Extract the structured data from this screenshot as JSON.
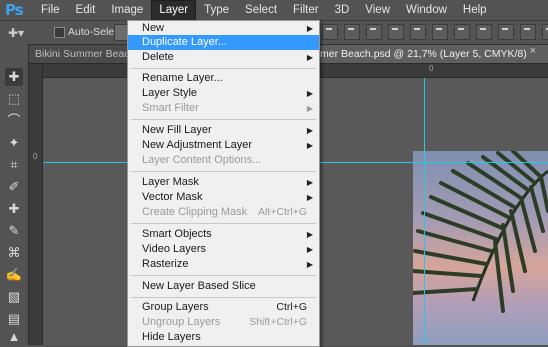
{
  "app": {
    "logo": "Ps"
  },
  "menubar": {
    "items": [
      "File",
      "Edit",
      "Image",
      "Layer",
      "Type",
      "Select",
      "Filter",
      "3D",
      "View",
      "Window",
      "Help"
    ],
    "active": "Layer"
  },
  "options": {
    "auto_select_label": "Auto-Select:"
  },
  "tabs": [
    {
      "label": "Bikini Summer Beach..."
    },
    {
      "label": "mer Beach.psd @ 21,7% (Layer 5, CMYK/8)",
      "close": "×"
    }
  ],
  "ruler": {
    "zero_top": "0",
    "zero_left": "0"
  },
  "layer_menu": {
    "new": "New",
    "duplicate_layer": "Duplicate Layer...",
    "delete": "Delete",
    "rename_layer": "Rename Layer...",
    "layer_style": "Layer Style",
    "smart_filter": "Smart Filter",
    "new_fill_layer": "New Fill Layer",
    "new_adjustment_layer": "New Adjustment Layer",
    "layer_content_options": "Layer Content Options...",
    "layer_mask": "Layer Mask",
    "vector_mask": "Vector Mask",
    "create_clipping_mask": "Create Clipping Mask",
    "create_clipping_mask_shortcut": "Alt+Ctrl+G",
    "smart_objects": "Smart Objects",
    "video_layers": "Video Layers",
    "rasterize": "Rasterize",
    "new_layer_based_slice": "New Layer Based Slice",
    "group_layers": "Group Layers",
    "group_layers_shortcut": "Ctrl+G",
    "ungroup_layers": "Ungroup Layers",
    "ungroup_layers_shortcut": "Shift+Ctrl+G",
    "hide_layers": "Hide Layers",
    "highlighted": "Duplicate Layer..."
  },
  "colors": {
    "highlight": "#3399ff",
    "guide": "#27c7e8",
    "logo": "#3ea2ee"
  }
}
